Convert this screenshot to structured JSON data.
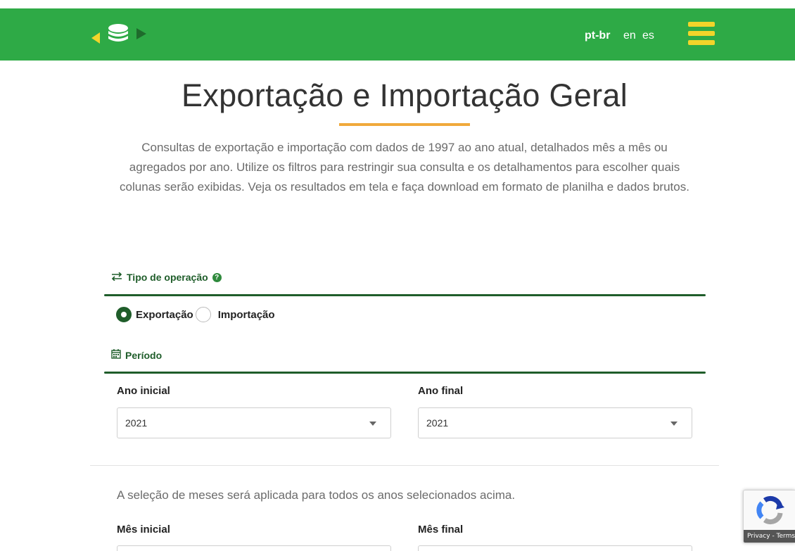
{
  "header": {
    "languages": [
      {
        "code": "pt-br",
        "active": true
      },
      {
        "code": "en",
        "active": false
      },
      {
        "code": "es",
        "active": false
      }
    ],
    "brand_color": "#2eaa46",
    "menu_color": "#f2d42a"
  },
  "main": {
    "title": "Exportação e Importação Geral",
    "intro": "Consultas de exportação e importação com dados de 1997 ao ano atual, detalhados mês a mês ou agregados por ano. Utilize os filtros para restringir sua consulta e os detalhamentos para escolher quais colunas serão exibidas. Veja os resultados em tela e faça download em formato de planilha e dados brutos."
  },
  "operation": {
    "heading": "Tipo de operação",
    "options": [
      {
        "label": "Exportação",
        "checked": true
      },
      {
        "label": "Importação",
        "checked": false
      }
    ]
  },
  "period": {
    "heading": "Período",
    "start_year_label": "Ano inicial",
    "start_year_value": "2021",
    "end_year_label": "Ano final",
    "end_year_value": "2021",
    "month_note": "A seleção de meses será aplicada para todos os anos selecionados acima.",
    "start_month_label": "Mês inicial",
    "end_month_label": "Mês final"
  },
  "recaptcha": {
    "footer": "Privacy - Terms"
  }
}
